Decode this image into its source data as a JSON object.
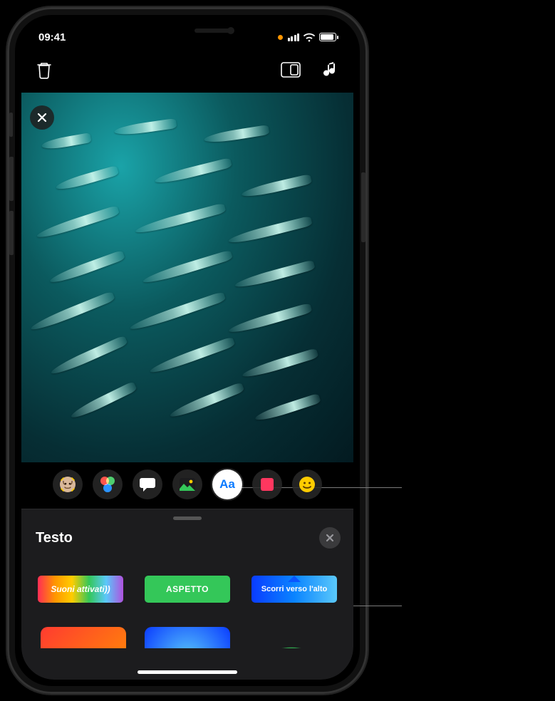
{
  "status": {
    "time": "09:41"
  },
  "toolbar": {
    "trash_name": "delete-icon",
    "aspect_name": "aspect-icon",
    "music_name": "music-icon"
  },
  "close_overlay": {
    "name": "close-icon"
  },
  "effects": {
    "items": [
      {
        "name": "memoji-icon"
      },
      {
        "name": "filters-icon"
      },
      {
        "name": "speech-bubble-icon"
      },
      {
        "name": "scene-icon"
      },
      {
        "name": "text-icon",
        "label": "Aa",
        "active": true
      },
      {
        "name": "shapes-icon"
      },
      {
        "name": "emoji-icon"
      }
    ]
  },
  "sheet": {
    "title": "Testo",
    "close_name": "close-icon",
    "labels": [
      {
        "name": "label-style-sound-on",
        "text": "Suoni attivati))"
      },
      {
        "name": "label-style-aspect",
        "text": "ASPETTO"
      },
      {
        "name": "label-style-swipe-up",
        "text": "Scorri verso l'alto"
      }
    ]
  }
}
